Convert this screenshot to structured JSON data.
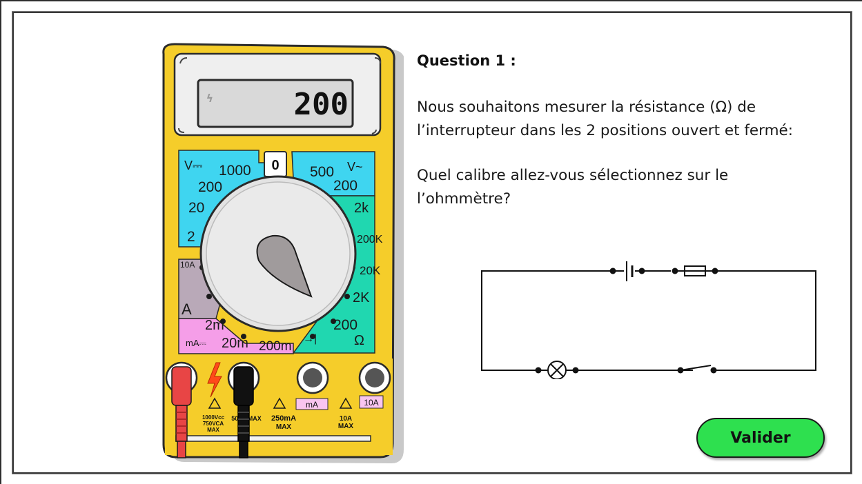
{
  "question": {
    "title": "Question 1 :",
    "line1a": "Nous souhaitons mesurer la résistance (Ω) de",
    "line1b": "l’interrupteur dans les 2 positions ouvert et fermé:",
    "line2a": "Quel calibre allez-vous sélectionnez sur le",
    "line2b": "l’ohmmètre?"
  },
  "button": {
    "validate": "Valider"
  },
  "multimeter": {
    "display": "200",
    "dial": {
      "vdc_symbol": "V⎓",
      "vac_symbol": "V~",
      "off": "0",
      "v_dc": [
        "1000",
        "200",
        "20",
        "2"
      ],
      "v_ac": [
        "500",
        "200"
      ],
      "ohm_upper": [
        "2k",
        "200K",
        "20K",
        "2K"
      ],
      "ohm_lower": "200",
      "ohm_symbol": "Ω",
      "amp_10a": "10A",
      "amp_symbol": "A",
      "ma": [
        "2m",
        "20m",
        "200m"
      ],
      "ma_symbol": "mA⎓",
      "diode_symbol": "→|"
    },
    "jacks": {
      "ma_label": "mA",
      "ten_a_label": "10A",
      "warn1": [
        "1000Vcc",
        "750VCA",
        "MAX"
      ],
      "warn2": "500V MAX",
      "warn3": [
        "250mA",
        "MAX"
      ],
      "warn4": [
        "10A",
        "MAX"
      ]
    }
  },
  "colors": {
    "body": "#f5cd2a",
    "volt_zone": "#3fd5f0",
    "ohm_zone": "#20d7b0",
    "ma_zone": "#f59ee8",
    "amp_zone": "#b9a9b8",
    "validate_button": "#2ee04f"
  }
}
